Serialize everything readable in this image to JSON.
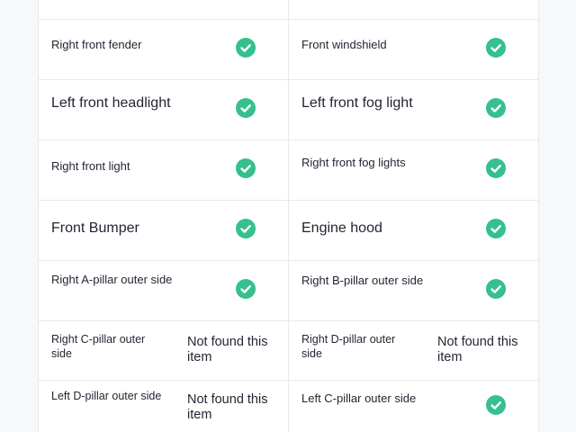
{
  "rows": [
    {
      "left": {
        "label": "Right front fender",
        "status": "check"
      },
      "right": {
        "label": "Front windshield",
        "status": "check"
      }
    },
    {
      "left": {
        "label": "Left front headlight",
        "status": "check"
      },
      "right": {
        "label": "Left front fog light",
        "status": "check"
      }
    },
    {
      "left": {
        "label": "Right front light",
        "status": "check"
      },
      "right": {
        "label": "Right front fog lights",
        "status": "check"
      }
    },
    {
      "left": {
        "label": "Front Bumper",
        "status": "check"
      },
      "right": {
        "label": "Engine hood",
        "status": "check"
      }
    },
    {
      "left": {
        "label": "Right A-pillar outer side",
        "status": "check"
      },
      "right": {
        "label": "Right B-pillar outer side",
        "status": "check"
      }
    },
    {
      "left": {
        "label": "Right C-pillar outer side",
        "status": "Not found this item"
      },
      "right": {
        "label": "Right D-pillar outer side",
        "status": "Not found this item"
      }
    },
    {
      "left": {
        "label": "Left D-pillar outer side",
        "status": "Not found this item"
      },
      "right": {
        "label": "Left C-pillar outer side",
        "status": "check"
      }
    }
  ],
  "colors": {
    "check": "#35c08e",
    "text": "#1f2430",
    "border": "#e7e9ee"
  },
  "icons": {
    "status_ok": "check-circle-icon"
  }
}
